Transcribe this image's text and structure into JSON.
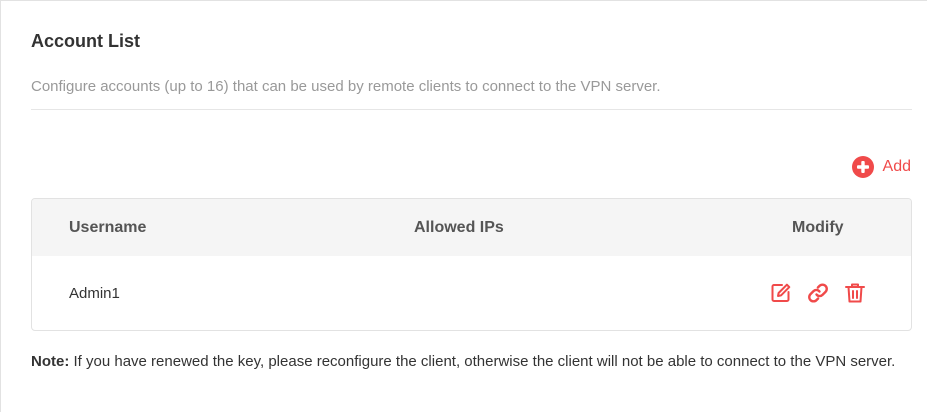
{
  "section": {
    "title": "Account List",
    "description": "Configure accounts (up to 16) that can be used by remote clients to connect to the VPN server."
  },
  "toolbar": {
    "add_label": "Add"
  },
  "table": {
    "columns": [
      "Username",
      "Allowed IPs",
      "Modify"
    ],
    "rows": [
      {
        "username": "Admin1",
        "allowed_ips": ""
      }
    ]
  },
  "note": {
    "label": "Note:",
    "text": " If you have renewed the key, please reconfigure the client, otherwise the client will not be able to connect to the VPN server."
  },
  "icons": {
    "add": "plus-circle-icon",
    "edit": "edit-icon",
    "link": "link-icon",
    "delete": "trash-icon"
  },
  "colors": {
    "accent": "#f04a4a",
    "header_bg": "#f5f5f5",
    "muted_text": "#999999"
  }
}
